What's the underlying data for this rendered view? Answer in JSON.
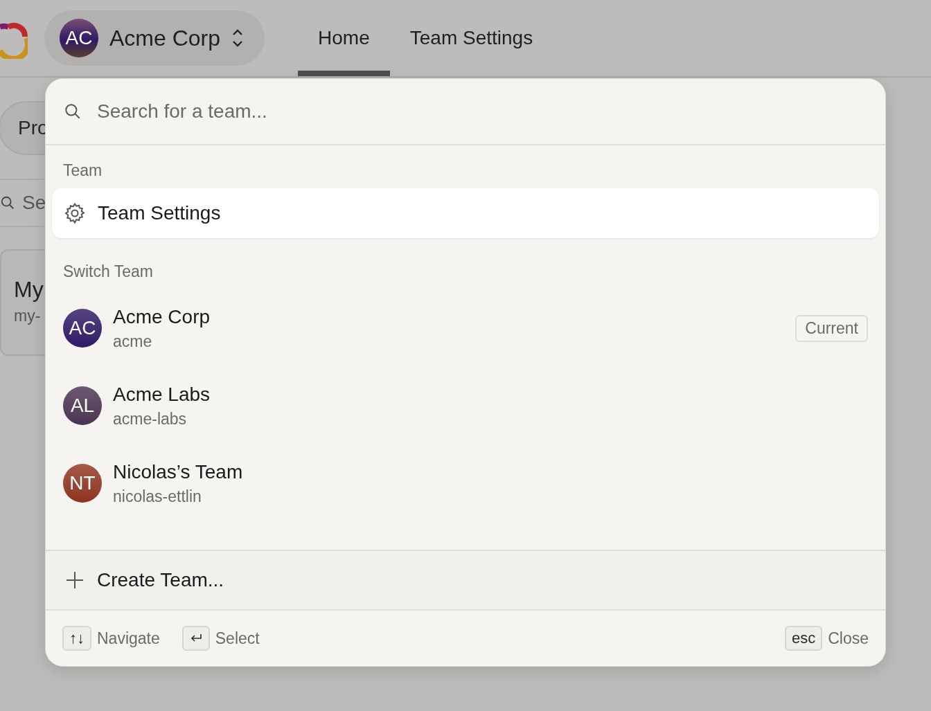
{
  "header": {
    "team_switcher": {
      "initials": "AC",
      "name": "Acme Corp",
      "color": "#2e1a66"
    },
    "tabs": [
      {
        "label": "Home",
        "selected": true
      },
      {
        "label": "Team Settings",
        "selected": false
      }
    ]
  },
  "background": {
    "projects_button": "Pro",
    "search_placeholder": "Se",
    "project_card": {
      "title": "My",
      "slug": "my-"
    }
  },
  "popup": {
    "search": {
      "placeholder": "Search for a team..."
    },
    "sections": [
      {
        "heading": "Team",
        "items": [
          {
            "kind": "action",
            "label": "Team Settings",
            "selected": true
          }
        ]
      },
      {
        "heading": "Switch Team",
        "items": [
          {
            "kind": "team",
            "initials": "AC",
            "name": "Acme Corp",
            "slug": "acme",
            "color": "#2e1a66",
            "current": true,
            "badge": "Current",
            "selected": false
          },
          {
            "kind": "team",
            "initials": "AL",
            "name": "Acme Labs",
            "slug": "acme-labs",
            "color": "#4a3350",
            "current": false,
            "selected": false
          },
          {
            "kind": "team",
            "initials": "NT",
            "name": "Nicolas’s Team",
            "slug": "nicolas-ettlin",
            "color": "#8e3420",
            "current": false,
            "selected": false
          }
        ]
      }
    ],
    "create": "Create Team...",
    "footer": {
      "hints": [
        {
          "kind": "text",
          "key": "↑↓",
          "label": "Navigate"
        },
        {
          "kind": "return",
          "label": "Select"
        }
      ],
      "close": {
        "key": "esc",
        "label": "Close"
      }
    }
  }
}
